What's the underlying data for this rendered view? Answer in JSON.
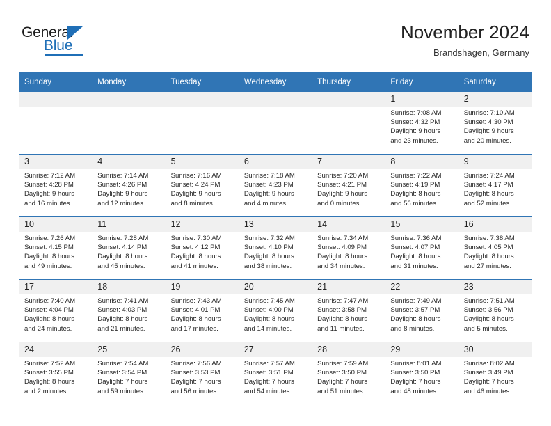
{
  "brand": {
    "name_part1": "General",
    "name_part2": "Blue",
    "triangle_color": "#1f6fb7"
  },
  "header": {
    "title": "November 2024",
    "subtitle": "Brandshagen, Germany",
    "accent_color": "#3075b5",
    "daynum_band_color": "#f0f0f0"
  },
  "weekdays": [
    "Sunday",
    "Monday",
    "Tuesday",
    "Wednesday",
    "Thursday",
    "Friday",
    "Saturday"
  ],
  "labels": {
    "sunrise_prefix": "Sunrise:",
    "sunset_prefix": "Sunset:",
    "daylight_prefix": "Daylight:"
  },
  "weeks": [
    [
      {
        "day": "",
        "empty": true
      },
      {
        "day": "",
        "empty": true
      },
      {
        "day": "",
        "empty": true
      },
      {
        "day": "",
        "empty": true
      },
      {
        "day": "",
        "empty": true
      },
      {
        "day": "1",
        "sunrise": "Sunrise: 7:08 AM",
        "sunset": "Sunset: 4:32 PM",
        "daylight1": "Daylight: 9 hours",
        "daylight2": "and 23 minutes."
      },
      {
        "day": "2",
        "sunrise": "Sunrise: 7:10 AM",
        "sunset": "Sunset: 4:30 PM",
        "daylight1": "Daylight: 9 hours",
        "daylight2": "and 20 minutes."
      }
    ],
    [
      {
        "day": "3",
        "sunrise": "Sunrise: 7:12 AM",
        "sunset": "Sunset: 4:28 PM",
        "daylight1": "Daylight: 9 hours",
        "daylight2": "and 16 minutes."
      },
      {
        "day": "4",
        "sunrise": "Sunrise: 7:14 AM",
        "sunset": "Sunset: 4:26 PM",
        "daylight1": "Daylight: 9 hours",
        "daylight2": "and 12 minutes."
      },
      {
        "day": "5",
        "sunrise": "Sunrise: 7:16 AM",
        "sunset": "Sunset: 4:24 PM",
        "daylight1": "Daylight: 9 hours",
        "daylight2": "and 8 minutes."
      },
      {
        "day": "6",
        "sunrise": "Sunrise: 7:18 AM",
        "sunset": "Sunset: 4:23 PM",
        "daylight1": "Daylight: 9 hours",
        "daylight2": "and 4 minutes."
      },
      {
        "day": "7",
        "sunrise": "Sunrise: 7:20 AM",
        "sunset": "Sunset: 4:21 PM",
        "daylight1": "Daylight: 9 hours",
        "daylight2": "and 0 minutes."
      },
      {
        "day": "8",
        "sunrise": "Sunrise: 7:22 AM",
        "sunset": "Sunset: 4:19 PM",
        "daylight1": "Daylight: 8 hours",
        "daylight2": "and 56 minutes."
      },
      {
        "day": "9",
        "sunrise": "Sunrise: 7:24 AM",
        "sunset": "Sunset: 4:17 PM",
        "daylight1": "Daylight: 8 hours",
        "daylight2": "and 52 minutes."
      }
    ],
    [
      {
        "day": "10",
        "sunrise": "Sunrise: 7:26 AM",
        "sunset": "Sunset: 4:15 PM",
        "daylight1": "Daylight: 8 hours",
        "daylight2": "and 49 minutes."
      },
      {
        "day": "11",
        "sunrise": "Sunrise: 7:28 AM",
        "sunset": "Sunset: 4:14 PM",
        "daylight1": "Daylight: 8 hours",
        "daylight2": "and 45 minutes."
      },
      {
        "day": "12",
        "sunrise": "Sunrise: 7:30 AM",
        "sunset": "Sunset: 4:12 PM",
        "daylight1": "Daylight: 8 hours",
        "daylight2": "and 41 minutes."
      },
      {
        "day": "13",
        "sunrise": "Sunrise: 7:32 AM",
        "sunset": "Sunset: 4:10 PM",
        "daylight1": "Daylight: 8 hours",
        "daylight2": "and 38 minutes."
      },
      {
        "day": "14",
        "sunrise": "Sunrise: 7:34 AM",
        "sunset": "Sunset: 4:09 PM",
        "daylight1": "Daylight: 8 hours",
        "daylight2": "and 34 minutes."
      },
      {
        "day": "15",
        "sunrise": "Sunrise: 7:36 AM",
        "sunset": "Sunset: 4:07 PM",
        "daylight1": "Daylight: 8 hours",
        "daylight2": "and 31 minutes."
      },
      {
        "day": "16",
        "sunrise": "Sunrise: 7:38 AM",
        "sunset": "Sunset: 4:05 PM",
        "daylight1": "Daylight: 8 hours",
        "daylight2": "and 27 minutes."
      }
    ],
    [
      {
        "day": "17",
        "sunrise": "Sunrise: 7:40 AM",
        "sunset": "Sunset: 4:04 PM",
        "daylight1": "Daylight: 8 hours",
        "daylight2": "and 24 minutes."
      },
      {
        "day": "18",
        "sunrise": "Sunrise: 7:41 AM",
        "sunset": "Sunset: 4:03 PM",
        "daylight1": "Daylight: 8 hours",
        "daylight2": "and 21 minutes."
      },
      {
        "day": "19",
        "sunrise": "Sunrise: 7:43 AM",
        "sunset": "Sunset: 4:01 PM",
        "daylight1": "Daylight: 8 hours",
        "daylight2": "and 17 minutes."
      },
      {
        "day": "20",
        "sunrise": "Sunrise: 7:45 AM",
        "sunset": "Sunset: 4:00 PM",
        "daylight1": "Daylight: 8 hours",
        "daylight2": "and 14 minutes."
      },
      {
        "day": "21",
        "sunrise": "Sunrise: 7:47 AM",
        "sunset": "Sunset: 3:58 PM",
        "daylight1": "Daylight: 8 hours",
        "daylight2": "and 11 minutes."
      },
      {
        "day": "22",
        "sunrise": "Sunrise: 7:49 AM",
        "sunset": "Sunset: 3:57 PM",
        "daylight1": "Daylight: 8 hours",
        "daylight2": "and 8 minutes."
      },
      {
        "day": "23",
        "sunrise": "Sunrise: 7:51 AM",
        "sunset": "Sunset: 3:56 PM",
        "daylight1": "Daylight: 8 hours",
        "daylight2": "and 5 minutes."
      }
    ],
    [
      {
        "day": "24",
        "sunrise": "Sunrise: 7:52 AM",
        "sunset": "Sunset: 3:55 PM",
        "daylight1": "Daylight: 8 hours",
        "daylight2": "and 2 minutes."
      },
      {
        "day": "25",
        "sunrise": "Sunrise: 7:54 AM",
        "sunset": "Sunset: 3:54 PM",
        "daylight1": "Daylight: 7 hours",
        "daylight2": "and 59 minutes."
      },
      {
        "day": "26",
        "sunrise": "Sunrise: 7:56 AM",
        "sunset": "Sunset: 3:53 PM",
        "daylight1": "Daylight: 7 hours",
        "daylight2": "and 56 minutes."
      },
      {
        "day": "27",
        "sunrise": "Sunrise: 7:57 AM",
        "sunset": "Sunset: 3:51 PM",
        "daylight1": "Daylight: 7 hours",
        "daylight2": "and 54 minutes."
      },
      {
        "day": "28",
        "sunrise": "Sunrise: 7:59 AM",
        "sunset": "Sunset: 3:50 PM",
        "daylight1": "Daylight: 7 hours",
        "daylight2": "and 51 minutes."
      },
      {
        "day": "29",
        "sunrise": "Sunrise: 8:01 AM",
        "sunset": "Sunset: 3:50 PM",
        "daylight1": "Daylight: 7 hours",
        "daylight2": "and 48 minutes."
      },
      {
        "day": "30",
        "sunrise": "Sunrise: 8:02 AM",
        "sunset": "Sunset: 3:49 PM",
        "daylight1": "Daylight: 7 hours",
        "daylight2": "and 46 minutes."
      }
    ]
  ]
}
